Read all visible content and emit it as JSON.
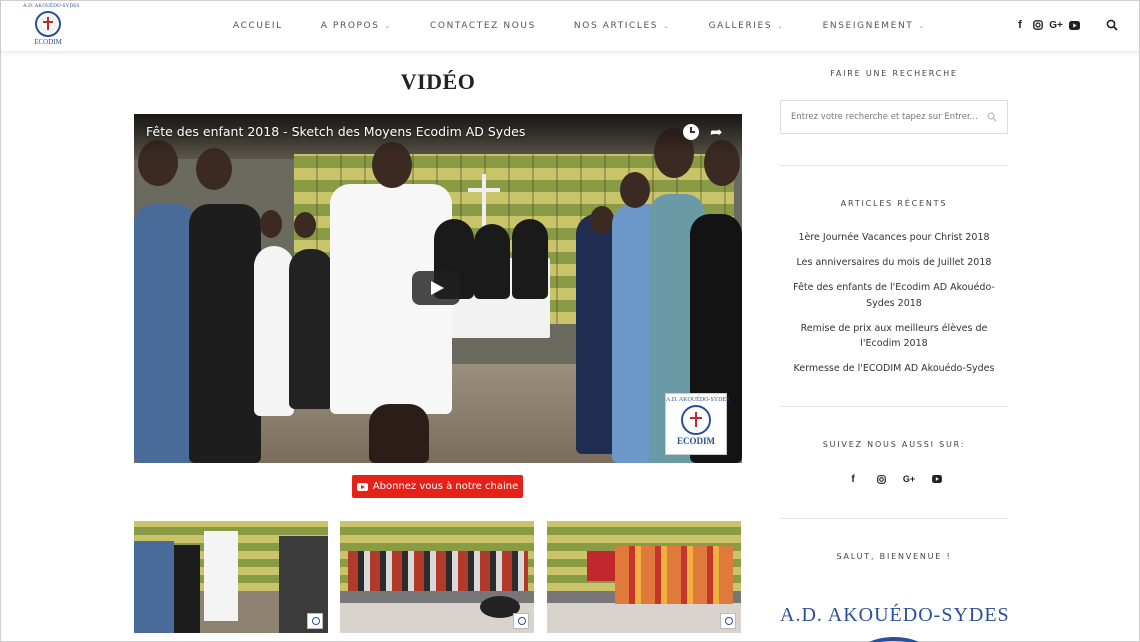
{
  "header": {
    "logo": {
      "top_text": "A.D. AKOUÉDO-SYDES",
      "bottom_text": "ECODIM"
    },
    "nav": [
      {
        "label": "ACCUEIL",
        "has_dropdown": false
      },
      {
        "label": "A PROPOS",
        "has_dropdown": true
      },
      {
        "label": "CONTACTEZ NOUS",
        "has_dropdown": false
      },
      {
        "label": "NOS ARTICLES",
        "has_dropdown": true
      },
      {
        "label": "GALLERIES",
        "has_dropdown": true
      },
      {
        "label": "ENSEIGNEMENT",
        "has_dropdown": true
      }
    ],
    "social_icons": [
      "facebook-icon",
      "instagram-icon",
      "google-plus-icon",
      "youtube-icon"
    ],
    "search_icon": "search-icon"
  },
  "main": {
    "title": "VIDÉO",
    "video": {
      "title": "Fête des enfant 2018 - Sketch des Moyens Ecodim AD Sydes",
      "watermark_top": "A.D. AKOUÉDO-SYDES",
      "watermark_bottom": "ECODIM"
    },
    "subscribe_label": "Abonnez vous à notre chaine",
    "thumbnails": 3
  },
  "sidebar": {
    "search": {
      "heading": "FAIRE UNE RECHERCHE",
      "placeholder": "Entrez votre recherche et tapez sur Entrer..."
    },
    "recent": {
      "heading": "ARTICLES RÉCENTS",
      "items": [
        "1ère Journée Vacances pour Christ 2018",
        "Les anniversaires du mois de Juillet 2018",
        "Fête des enfants de l'Ecodim AD Akouédo-Sydes 2018",
        "Remise de prix aux meilleurs élèves de l'Ecodim 2018",
        "Kermesse de l'ECODIM AD Akouédo-Sydes"
      ]
    },
    "follow": {
      "heading": "SUIVEZ NOUS AUSSI SUR:"
    },
    "welcome": {
      "heading": "SALUT, BIENVENUE !",
      "brand": "A.D. AKOUÉDO-SYDES"
    }
  },
  "colors": {
    "brand_blue": "#2a4f9a",
    "youtube_red": "#e62117",
    "text_dark": "#333333"
  }
}
